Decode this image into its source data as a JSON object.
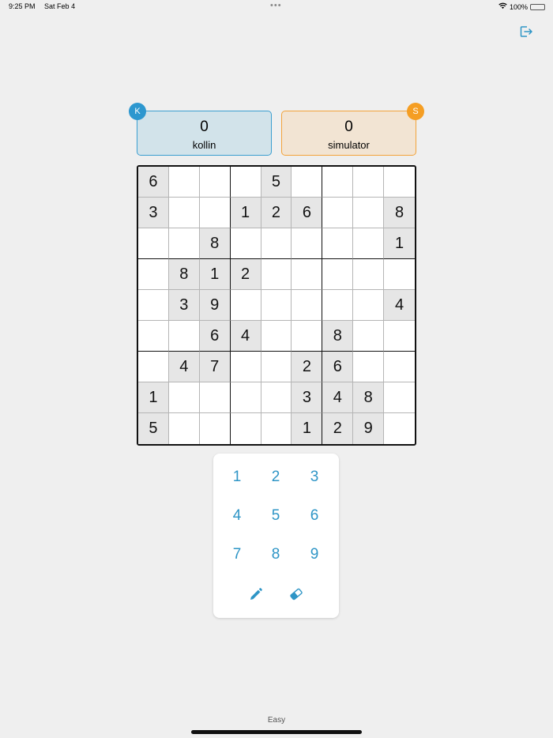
{
  "status_bar": {
    "time": "9:25 PM",
    "date": "Sat Feb 4",
    "dots": "•••",
    "battery": "100%",
    "battery_level": 1.0
  },
  "icons": {
    "exit": "exit-icon",
    "wifi": "wifi-icon",
    "battery": "battery-icon",
    "pencil": "pencil-icon",
    "eraser": "eraser-icon"
  },
  "players": [
    {
      "initial": "K",
      "score": "0",
      "name": "kollin",
      "color": "#2d97cf"
    },
    {
      "initial": "S",
      "score": "0",
      "name": "simulator",
      "color": "#f59e23"
    }
  ],
  "board": [
    [
      "6",
      "",
      "",
      "",
      "5",
      "",
      "",
      "",
      ""
    ],
    [
      "3",
      "",
      "",
      "1",
      "2",
      "6",
      "",
      "",
      "8"
    ],
    [
      "",
      "",
      "8",
      "",
      "",
      "",
      "",
      "",
      "1"
    ],
    [
      "",
      "8",
      "1",
      "2",
      "",
      "",
      "",
      "",
      ""
    ],
    [
      "",
      "3",
      "9",
      "",
      "",
      "",
      "",
      "",
      "4"
    ],
    [
      "",
      "",
      "6",
      "4",
      "",
      "",
      "8",
      "",
      ""
    ],
    [
      "",
      "4",
      "7",
      "",
      "",
      "2",
      "6",
      "",
      ""
    ],
    [
      "1",
      "",
      "",
      "",
      "",
      "3",
      "4",
      "8",
      ""
    ],
    [
      "5",
      "",
      "",
      "",
      "",
      "1",
      "2",
      "9",
      ""
    ]
  ],
  "numpad": {
    "keys": [
      "1",
      "2",
      "3",
      "4",
      "5",
      "6",
      "7",
      "8",
      "9"
    ]
  },
  "difficulty": "Easy",
  "colors": {
    "accent": "#2e95c6",
    "player1": "#3b9ed0",
    "player2": "#f3a33a",
    "given_cell": "#e6e6e6",
    "background": "#efefef"
  }
}
